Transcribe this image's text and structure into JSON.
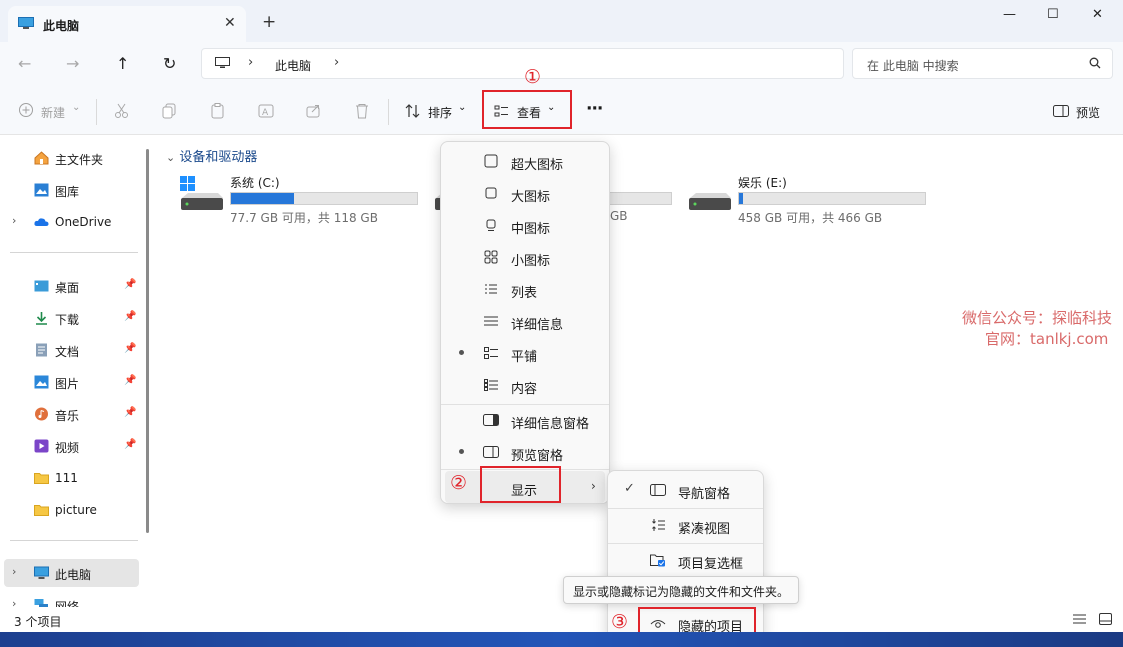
{
  "titlebar": {
    "tab_title": "此电脑",
    "close_glyph": "✕",
    "new_tab_glyph": "+",
    "minimize_glyph": "—",
    "maximize_glyph": "☐",
    "window_close_glyph": "✕"
  },
  "nav": {
    "back_glyph": "←",
    "forward_glyph": "→",
    "up_glyph": "↑",
    "refresh_glyph": "↻",
    "separator": "›",
    "address": "此电脑",
    "search_placeholder": "在 此电脑 中搜索"
  },
  "toolbar": {
    "new_label": "新建",
    "sort_label": "排序",
    "view_label": "查看",
    "more_label": "···",
    "preview_label": "预览",
    "chevron": "⌄"
  },
  "sidebar": {
    "items": [
      {
        "label": "主文件夹",
        "icon": "home-icon"
      },
      {
        "label": "图库",
        "icon": "gallery-icon"
      },
      {
        "label": "OneDrive",
        "icon": "cloud-icon"
      },
      {
        "label": "桌面",
        "icon": "desktop-icon"
      },
      {
        "label": "下载",
        "icon": "download-icon"
      },
      {
        "label": "文档",
        "icon": "document-icon"
      },
      {
        "label": "图片",
        "icon": "picture-icon"
      },
      {
        "label": "音乐",
        "icon": "music-icon"
      },
      {
        "label": "视频",
        "icon": "video-icon"
      },
      {
        "label": "111",
        "icon": "folder-icon"
      },
      {
        "label": "picture",
        "icon": "folder-icon"
      },
      {
        "label": "此电脑",
        "icon": "computer-icon"
      },
      {
        "label": "网络",
        "icon": "network-icon"
      }
    ],
    "chevron": "›",
    "pin_glyph": "📌"
  },
  "content": {
    "group_title": "设备和驱动器",
    "group_chevron": "⌄",
    "drives": [
      {
        "name": "系统 (C:)",
        "info": "77.7 GB 可用，共 118 GB",
        "used_fraction": 0.34
      },
      {
        "name": "",
        "info": "GB",
        "used_fraction": 0.0
      },
      {
        "name": "娱乐 (E:)",
        "info": "458 GB 可用，共 466 GB",
        "used_fraction": 0.02
      }
    ]
  },
  "view_menu": {
    "items": [
      {
        "label": "超大图标",
        "icon": "extra-large-icons-icon"
      },
      {
        "label": "大图标",
        "icon": "large-icons-icon"
      },
      {
        "label": "中图标",
        "icon": "medium-icons-icon"
      },
      {
        "label": "小图标",
        "icon": "small-icons-icon"
      },
      {
        "label": "列表",
        "icon": "list-icon"
      },
      {
        "label": "详细信息",
        "icon": "details-icon"
      },
      {
        "label": "平铺",
        "icon": "tiles-icon",
        "selected": true
      },
      {
        "label": "内容",
        "icon": "content-icon"
      },
      {
        "label": "详细信息窗格",
        "icon": "details-pane-icon"
      },
      {
        "label": "预览窗格",
        "icon": "preview-pane-icon",
        "selected": true
      },
      {
        "label": "显示",
        "icon": "",
        "submenu": true
      }
    ],
    "arrow": "›"
  },
  "show_submenu": {
    "items": [
      {
        "label": "导航窗格",
        "checked": true
      },
      {
        "label": "紧凑视图",
        "checked": false
      },
      {
        "label": "项目复选框",
        "checked": false
      },
      {
        "label": "隐藏的项目",
        "checked": false
      }
    ],
    "check_glyph": "✓"
  },
  "tooltip": "显示或隐藏标记为隐藏的文件和文件夹。",
  "annotations": {
    "step1": "①",
    "step2": "②",
    "step3": "③",
    "color": "#e0242b"
  },
  "status": {
    "count": "3 个项目"
  },
  "watermark": {
    "line1": "微信公众号：探临科技",
    "line2": "官网：tanlkj.com"
  }
}
